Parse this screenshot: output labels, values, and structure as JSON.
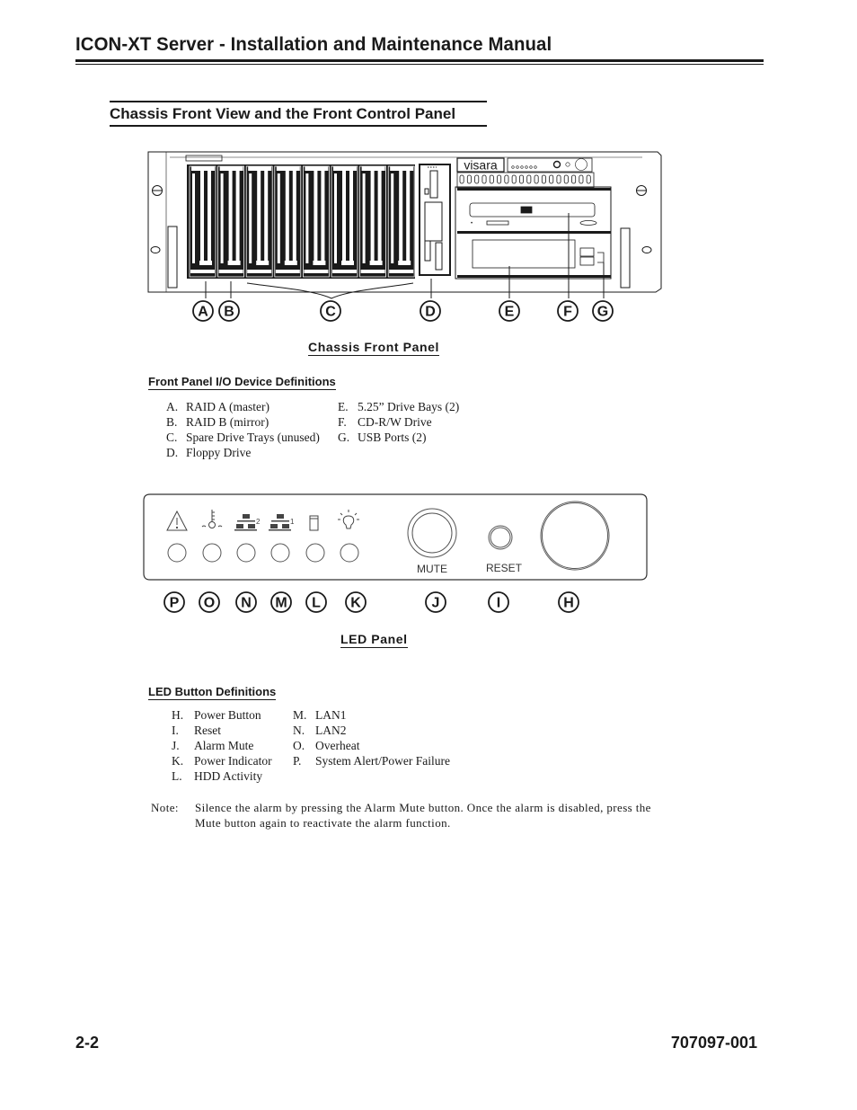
{
  "header": {
    "title": "ICON-XT Server - Installation and Maintenance Manual"
  },
  "section": {
    "title": "Chassis Front View and the Front Control Panel"
  },
  "chassis_figure": {
    "brand_logo": "visara",
    "callouts": [
      "A",
      "B",
      "C",
      "D",
      "E",
      "F",
      "G"
    ],
    "caption": "Chassis Front Panel"
  },
  "io_definitions": {
    "heading": "Front Panel I/O Device Definitions",
    "left": [
      {
        "key": "A.",
        "label": "RAID A (master)"
      },
      {
        "key": "B.",
        "label": "RAID B (mirror)"
      },
      {
        "key": "C.",
        "label": "Spare Drive Trays (unused)"
      },
      {
        "key": "D.",
        "label": "Floppy Drive"
      }
    ],
    "right": [
      {
        "key": "E.",
        "label": "5.25” Drive Bays (2)"
      },
      {
        "key": "F.",
        "label": "CD-R/W Drive"
      },
      {
        "key": "G.",
        "label": "USB Ports (2)"
      }
    ]
  },
  "led_figure": {
    "icons": [
      "warning-icon",
      "thermometer-icon",
      "network-icon",
      "network-icon",
      "hdd-icon",
      "lightbulb-icon"
    ],
    "lan2_superscript": "2",
    "lan1_superscript": "1",
    "mute_label": "MUTE",
    "reset_label": "RESET",
    "callouts": [
      "P",
      "O",
      "N",
      "M",
      "L",
      "K",
      "J",
      "I",
      "H"
    ],
    "caption": "LED Panel"
  },
  "led_definitions": {
    "heading": "LED Button Definitions",
    "left": [
      {
        "key": "H.",
        "label": "Power Button"
      },
      {
        "key": "I.",
        "label": "Reset"
      },
      {
        "key": "J.",
        "label": "Alarm Mute"
      },
      {
        "key": "K.",
        "label": "Power Indicator"
      },
      {
        "key": "L.",
        "label": "HDD Activity"
      }
    ],
    "right": [
      {
        "key": "M.",
        "label": "LAN1"
      },
      {
        "key": "N.",
        "label": "LAN2"
      },
      {
        "key": "O.",
        "label": "Overheat"
      },
      {
        "key": "P.",
        "label": "System Alert/Power Failure"
      }
    ]
  },
  "note": {
    "label": "Note:",
    "line1": "Silence the alarm by pressing the Alarm Mute button. Once the alarm is disabled, press the",
    "line2": "Mute button again to reactivate the alarm function."
  },
  "footer": {
    "page_number": "2-2",
    "doc_number": "707097-001"
  }
}
